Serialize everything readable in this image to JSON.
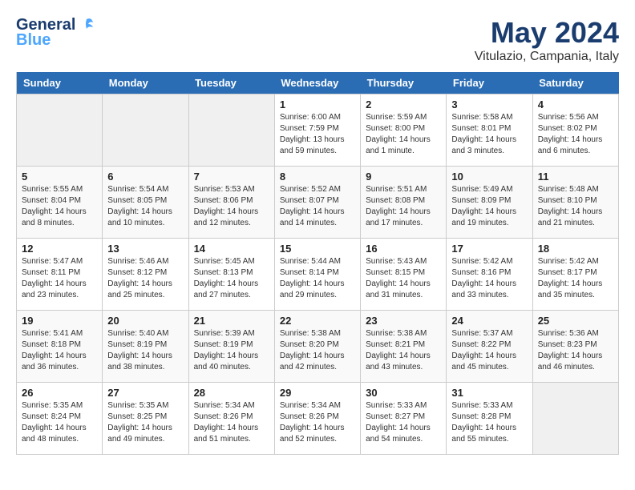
{
  "header": {
    "logo_general": "General",
    "logo_blue": "Blue",
    "month": "May 2024",
    "location": "Vitulazio, Campania, Italy"
  },
  "days_of_week": [
    "Sunday",
    "Monday",
    "Tuesday",
    "Wednesday",
    "Thursday",
    "Friday",
    "Saturday"
  ],
  "weeks": [
    [
      {
        "day": "",
        "empty": true
      },
      {
        "day": "",
        "empty": true
      },
      {
        "day": "",
        "empty": true
      },
      {
        "day": "1",
        "sunrise": "Sunrise: 6:00 AM",
        "sunset": "Sunset: 7:59 PM",
        "daylight": "Daylight: 13 hours and 59 minutes."
      },
      {
        "day": "2",
        "sunrise": "Sunrise: 5:59 AM",
        "sunset": "Sunset: 8:00 PM",
        "daylight": "Daylight: 14 hours and 1 minute."
      },
      {
        "day": "3",
        "sunrise": "Sunrise: 5:58 AM",
        "sunset": "Sunset: 8:01 PM",
        "daylight": "Daylight: 14 hours and 3 minutes."
      },
      {
        "day": "4",
        "sunrise": "Sunrise: 5:56 AM",
        "sunset": "Sunset: 8:02 PM",
        "daylight": "Daylight: 14 hours and 6 minutes."
      }
    ],
    [
      {
        "day": "5",
        "sunrise": "Sunrise: 5:55 AM",
        "sunset": "Sunset: 8:04 PM",
        "daylight": "Daylight: 14 hours and 8 minutes."
      },
      {
        "day": "6",
        "sunrise": "Sunrise: 5:54 AM",
        "sunset": "Sunset: 8:05 PM",
        "daylight": "Daylight: 14 hours and 10 minutes."
      },
      {
        "day": "7",
        "sunrise": "Sunrise: 5:53 AM",
        "sunset": "Sunset: 8:06 PM",
        "daylight": "Daylight: 14 hours and 12 minutes."
      },
      {
        "day": "8",
        "sunrise": "Sunrise: 5:52 AM",
        "sunset": "Sunset: 8:07 PM",
        "daylight": "Daylight: 14 hours and 14 minutes."
      },
      {
        "day": "9",
        "sunrise": "Sunrise: 5:51 AM",
        "sunset": "Sunset: 8:08 PM",
        "daylight": "Daylight: 14 hours and 17 minutes."
      },
      {
        "day": "10",
        "sunrise": "Sunrise: 5:49 AM",
        "sunset": "Sunset: 8:09 PM",
        "daylight": "Daylight: 14 hours and 19 minutes."
      },
      {
        "day": "11",
        "sunrise": "Sunrise: 5:48 AM",
        "sunset": "Sunset: 8:10 PM",
        "daylight": "Daylight: 14 hours and 21 minutes."
      }
    ],
    [
      {
        "day": "12",
        "sunrise": "Sunrise: 5:47 AM",
        "sunset": "Sunset: 8:11 PM",
        "daylight": "Daylight: 14 hours and 23 minutes."
      },
      {
        "day": "13",
        "sunrise": "Sunrise: 5:46 AM",
        "sunset": "Sunset: 8:12 PM",
        "daylight": "Daylight: 14 hours and 25 minutes."
      },
      {
        "day": "14",
        "sunrise": "Sunrise: 5:45 AM",
        "sunset": "Sunset: 8:13 PM",
        "daylight": "Daylight: 14 hours and 27 minutes."
      },
      {
        "day": "15",
        "sunrise": "Sunrise: 5:44 AM",
        "sunset": "Sunset: 8:14 PM",
        "daylight": "Daylight: 14 hours and 29 minutes."
      },
      {
        "day": "16",
        "sunrise": "Sunrise: 5:43 AM",
        "sunset": "Sunset: 8:15 PM",
        "daylight": "Daylight: 14 hours and 31 minutes."
      },
      {
        "day": "17",
        "sunrise": "Sunrise: 5:42 AM",
        "sunset": "Sunset: 8:16 PM",
        "daylight": "Daylight: 14 hours and 33 minutes."
      },
      {
        "day": "18",
        "sunrise": "Sunrise: 5:42 AM",
        "sunset": "Sunset: 8:17 PM",
        "daylight": "Daylight: 14 hours and 35 minutes."
      }
    ],
    [
      {
        "day": "19",
        "sunrise": "Sunrise: 5:41 AM",
        "sunset": "Sunset: 8:18 PM",
        "daylight": "Daylight: 14 hours and 36 minutes."
      },
      {
        "day": "20",
        "sunrise": "Sunrise: 5:40 AM",
        "sunset": "Sunset: 8:19 PM",
        "daylight": "Daylight: 14 hours and 38 minutes."
      },
      {
        "day": "21",
        "sunrise": "Sunrise: 5:39 AM",
        "sunset": "Sunset: 8:19 PM",
        "daylight": "Daylight: 14 hours and 40 minutes."
      },
      {
        "day": "22",
        "sunrise": "Sunrise: 5:38 AM",
        "sunset": "Sunset: 8:20 PM",
        "daylight": "Daylight: 14 hours and 42 minutes."
      },
      {
        "day": "23",
        "sunrise": "Sunrise: 5:38 AM",
        "sunset": "Sunset: 8:21 PM",
        "daylight": "Daylight: 14 hours and 43 minutes."
      },
      {
        "day": "24",
        "sunrise": "Sunrise: 5:37 AM",
        "sunset": "Sunset: 8:22 PM",
        "daylight": "Daylight: 14 hours and 45 minutes."
      },
      {
        "day": "25",
        "sunrise": "Sunrise: 5:36 AM",
        "sunset": "Sunset: 8:23 PM",
        "daylight": "Daylight: 14 hours and 46 minutes."
      }
    ],
    [
      {
        "day": "26",
        "sunrise": "Sunrise: 5:35 AM",
        "sunset": "Sunset: 8:24 PM",
        "daylight": "Daylight: 14 hours and 48 minutes."
      },
      {
        "day": "27",
        "sunrise": "Sunrise: 5:35 AM",
        "sunset": "Sunset: 8:25 PM",
        "daylight": "Daylight: 14 hours and 49 minutes."
      },
      {
        "day": "28",
        "sunrise": "Sunrise: 5:34 AM",
        "sunset": "Sunset: 8:26 PM",
        "daylight": "Daylight: 14 hours and 51 minutes."
      },
      {
        "day": "29",
        "sunrise": "Sunrise: 5:34 AM",
        "sunset": "Sunset: 8:26 PM",
        "daylight": "Daylight: 14 hours and 52 minutes."
      },
      {
        "day": "30",
        "sunrise": "Sunrise: 5:33 AM",
        "sunset": "Sunset: 8:27 PM",
        "daylight": "Daylight: 14 hours and 54 minutes."
      },
      {
        "day": "31",
        "sunrise": "Sunrise: 5:33 AM",
        "sunset": "Sunset: 8:28 PM",
        "daylight": "Daylight: 14 hours and 55 minutes."
      },
      {
        "day": "",
        "empty": true
      }
    ]
  ]
}
